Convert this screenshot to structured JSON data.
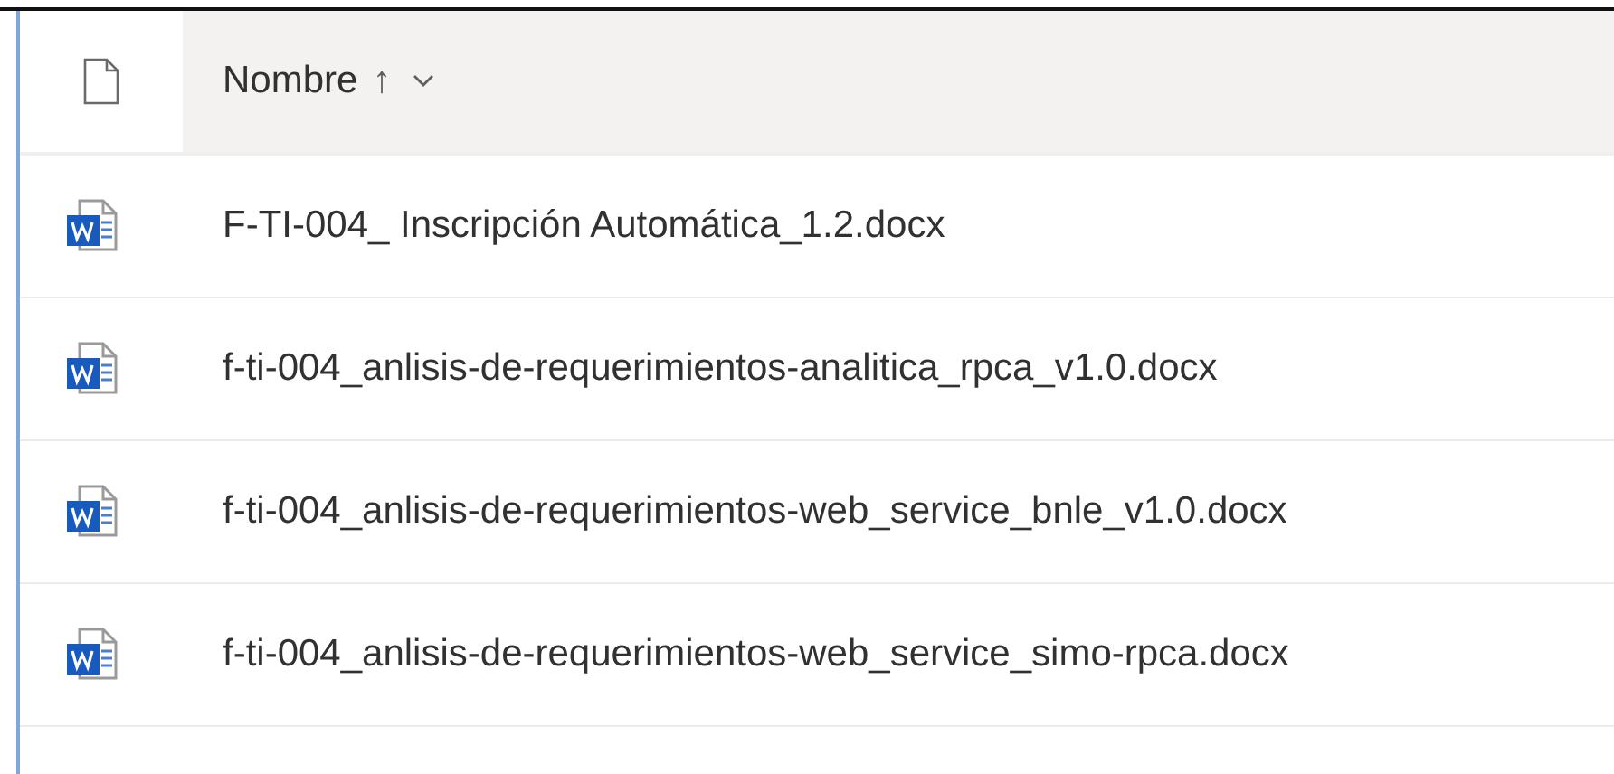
{
  "header": {
    "column_label": "Nombre",
    "sort_indicator": "↑"
  },
  "files": [
    {
      "name": "F-TI-004_ Inscripción Automática_1.2.docx"
    },
    {
      "name": "f-ti-004_anlisis-de-requerimientos-analitica_rpca_v1.0.docx"
    },
    {
      "name": "f-ti-004_anlisis-de-requerimientos-web_service_bnle_v1.0.docx"
    },
    {
      "name": "f-ti-004_anlisis-de-requerimientos-web_service_simo-rpca.docx"
    }
  ]
}
